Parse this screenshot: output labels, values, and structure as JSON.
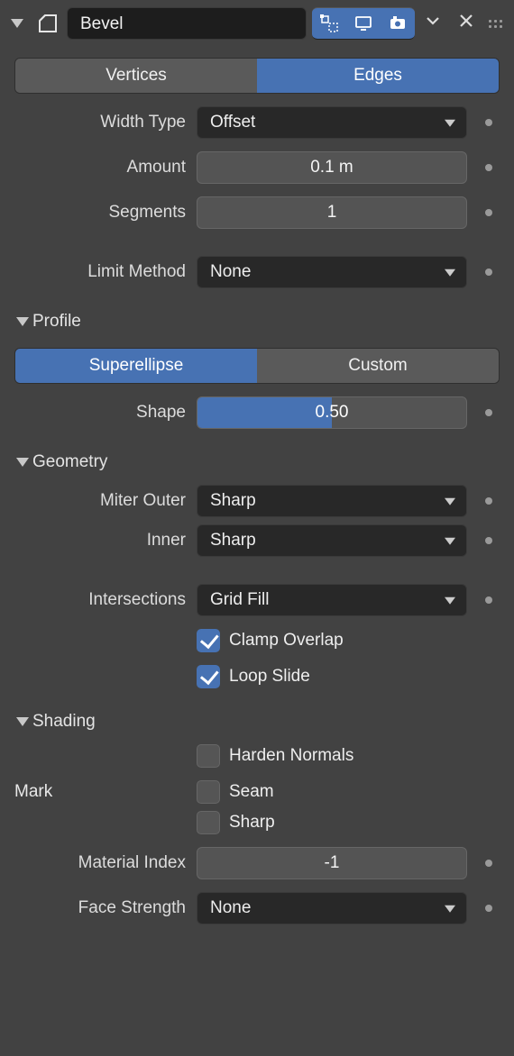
{
  "header": {
    "name": "Bevel",
    "display_edit_active": true,
    "display_viewport_active": true,
    "display_render_active": true
  },
  "tabs": {
    "vertices": "Vertices",
    "edges": "Edges",
    "active": "edges"
  },
  "width_type": {
    "label": "Width Type",
    "value": "Offset"
  },
  "amount": {
    "label": "Amount",
    "value": "0.1 m"
  },
  "segments": {
    "label": "Segments",
    "value": "1"
  },
  "limit": {
    "label": "Limit Method",
    "value": "None"
  },
  "profile": {
    "title": "Profile",
    "tabs": {
      "super": "Superellipse",
      "custom": "Custom",
      "active": "super"
    },
    "shape": {
      "label": "Shape",
      "value": "0.50",
      "fill_pct": 50
    }
  },
  "geometry": {
    "title": "Geometry",
    "miter_outer": {
      "label": "Miter Outer",
      "value": "Sharp"
    },
    "miter_inner": {
      "label": "Inner",
      "value": "Sharp"
    },
    "intersections": {
      "label": "Intersections",
      "value": "Grid Fill"
    },
    "clamp": {
      "label": "Clamp Overlap",
      "checked": true
    },
    "loopslide": {
      "label": "Loop Slide",
      "checked": true
    }
  },
  "shading": {
    "title": "Shading",
    "harden": {
      "label": "Harden Normals",
      "checked": false
    },
    "mark_label": "Mark",
    "seam": {
      "label": "Seam",
      "checked": false
    },
    "sharp": {
      "label": "Sharp",
      "checked": false
    },
    "mat_index": {
      "label": "Material Index",
      "value": "-1"
    },
    "face_str": {
      "label": "Face Strength",
      "value": "None"
    }
  }
}
